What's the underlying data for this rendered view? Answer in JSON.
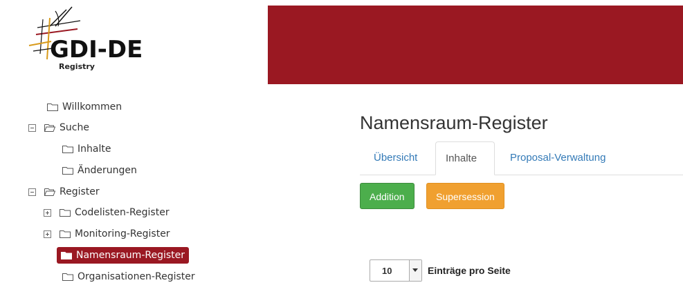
{
  "header": {
    "logo_title": "GDI-DE",
    "logo_subtitle": "Registry",
    "brand_color": "#9a1822"
  },
  "tree": {
    "items": [
      {
        "label": "Willkommen",
        "toggle": "none",
        "icon": "folder-closed-icon"
      },
      {
        "label": "Suche",
        "toggle": "minus",
        "icon": "folder-open-icon"
      },
      {
        "label": "Inhalte",
        "toggle": "none",
        "icon": "folder-closed-icon"
      },
      {
        "label": "Änderungen",
        "toggle": "none",
        "icon": "folder-closed-icon"
      },
      {
        "label": "Register",
        "toggle": "minus",
        "icon": "folder-open-icon"
      },
      {
        "label": "Codelisten-Register",
        "toggle": "plus",
        "icon": "folder-closed-icon"
      },
      {
        "label": "Monitoring-Register",
        "toggle": "plus",
        "icon": "folder-closed-icon"
      },
      {
        "label": "Namensraum-Register",
        "toggle": "none",
        "icon": "folder-filled-icon",
        "selected": true
      },
      {
        "label": "Organisationen-Register",
        "toggle": "none",
        "icon": "folder-closed-icon"
      }
    ]
  },
  "main": {
    "title": "Namensraum-Register",
    "tabs": [
      {
        "label": "Übersicht",
        "active": false
      },
      {
        "label": "Inhalte",
        "active": true
      },
      {
        "label": "Proposal-Verwaltung",
        "active": false
      }
    ],
    "buttons": {
      "addition": "Addition",
      "supersession": "Supersession"
    },
    "pager": {
      "page_size": "10",
      "label": "Einträge pro Seite"
    }
  }
}
